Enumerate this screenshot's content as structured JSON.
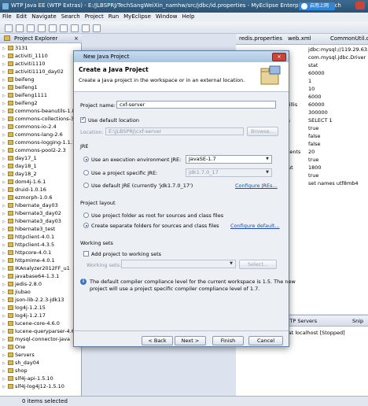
{
  "window": {
    "title": "WTP Java EE (WTP Extras) - E:/JLBSPRJ/TechSangWeiXin_namhw/src/jdbc/id.properties - MyEclipse Enterprise Workbench",
    "badge_label": "启用上网"
  },
  "menu": [
    "File",
    "Edit",
    "Navigate",
    "Search",
    "Project",
    "Run",
    "MyEclipse",
    "Window",
    "Help"
  ],
  "package_explorer": {
    "title": "Project Explorer",
    "items": [
      "3131",
      "activiti_1110",
      "activiti1110",
      "activiti1110_day02",
      "beifeng",
      "beifeng1",
      "beifeng1111",
      "beifeng2",
      "commons-beanutils-1.8.0",
      "commons-collections-3.2.1",
      "commons-io-2.4",
      "commons-lang-2.6",
      "commons-logging-1.1.1",
      "commons-pool2-2.3",
      "day17_1",
      "day18_1",
      "day18_2",
      "dom4j-1.6.1",
      "druid-1.0.16",
      "ezmorph-1.0.6",
      "hibernate_day03",
      "hibernate3_day02",
      "hibernate3_day03",
      "hibernate3_test",
      "httpclient-4.0.1",
      "httpclient-4.3.5",
      "httpcore-4.0.1",
      "httpmime-4.0.1",
      "IKAnalyzer2012FF_u1",
      "javabase64-1.3.1",
      "jedis-2.8.0",
      "jiubao",
      "json-lib-2.2.3-jdk13",
      "log4j-1.2.15",
      "log4j-1.2.17",
      "lucene-core-4.6.0",
      "lucene-queryparser-4.6.0",
      "mysql-connector-java",
      "One",
      "Servers",
      "sh_day04",
      "shop",
      "slf4j-api-1.5.10",
      "slf4j-log4j12-1.5.10"
    ]
  },
  "editor": {
    "tabs": [
      "redis.properties",
      "web.xml",
      "CommonUtil.cl"
    ],
    "values": [
      "jdbc:mysql://119.29.63.112",
      "com.mysql.jdbc.Driver",
      "stat",
      "60000",
      "1",
      "10",
      "6000",
      "60000",
      "300000",
      "SELECT 1",
      "true",
      "false",
      "false",
      "20",
      "true",
      "1800",
      "true",
      "set names utf8mb4"
    ],
    "labels": [
      "Millis",
      "lis",
      "ments",
      "out"
    ]
  },
  "servers_panel": {
    "tab_label": "WTP Servers",
    "tab2_label": "Snip",
    "row": "r at localhost  [Stopped]"
  },
  "status_bar": {
    "text": "0 items selected"
  },
  "dialog": {
    "title": "New Java Project",
    "header": "Create a Java Project",
    "description": "Create a Java project in the workspace or in an external location.",
    "project_name_label": "Project name:",
    "project_name_value": "cxf-server",
    "use_default_location_label": "Use default location",
    "location_label": "Location:",
    "location_value": "E:\\JLBSPRJ\\cxf-server",
    "browse_label": "Browse...",
    "jre_group": "JRE",
    "jre_opt1_label": "Use an execution environment JRE:",
    "jre_opt1_value": "JavaSE-1.7",
    "jre_opt2_label": "Use a project specific JRE:",
    "jre_opt2_value": "jdk1.7.0_17",
    "jre_opt3_label": "Use default JRE (currently 'jdk1.7.0_17')",
    "configure_jres": "Configure JREs...",
    "layout_group": "Project layout",
    "layout_opt1": "Use project folder as root for sources and class files",
    "layout_opt2": "Create separate folders for sources and class files",
    "configure_default": "Configure default...",
    "working_sets_group": "Working sets",
    "add_working_sets_label": "Add project to working sets",
    "working_sets_label": "Working sets:",
    "select_label": "Select...",
    "info_text_line1": "The default compiler compliance level for the current workspace is 1.5. The new",
    "info_text_line2": "project will use a project specific compiler compliance level of 1.7.",
    "back_label": "< Back",
    "next_label": "Next >",
    "finish_label": "Finish",
    "cancel_label": "Cancel"
  },
  "colors": {
    "accent": "#2a4f86",
    "link": "#1d4ea3",
    "dialog_border": "#5b7fa6"
  }
}
